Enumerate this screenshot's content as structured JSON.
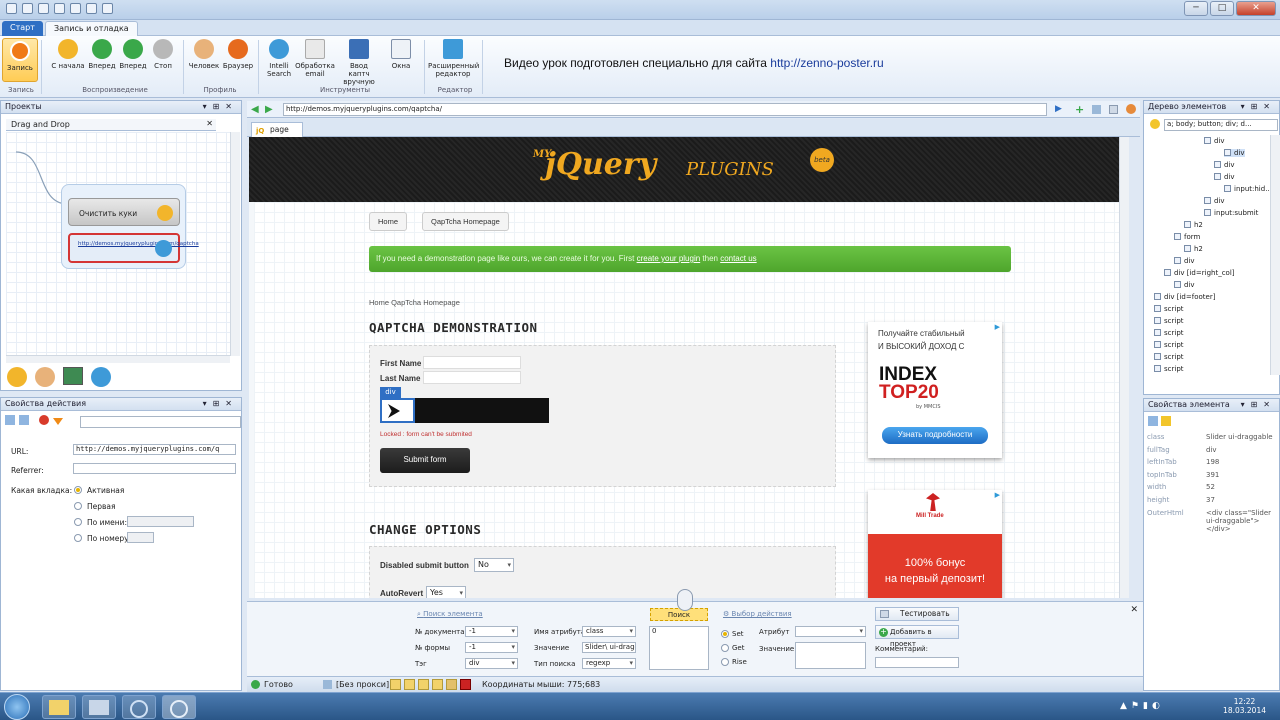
{
  "titlebar": {
    "buttons": [
      "─",
      "□",
      "✕"
    ]
  },
  "tabs": {
    "start": "Старт",
    "record": "Запись и отладка"
  },
  "ribbon": {
    "buttons": [
      {
        "label": "Запись",
        "icon": "record-icon",
        "color": "#f07a16"
      },
      {
        "label": "С начала",
        "icon": "restart-icon",
        "color": "#f2b52b"
      },
      {
        "label": "Вперед",
        "icon": "play-icon",
        "color": "#3aa84a"
      },
      {
        "label": "Вперед",
        "icon": "step-forward-icon",
        "color": "#3aa84a"
      },
      {
        "label": "Стоп",
        "icon": "stop-icon",
        "color": "#b8b8b8"
      },
      {
        "label": "Человек",
        "icon": "person-icon",
        "color": "#e8b27a"
      },
      {
        "label": "Браузер",
        "icon": "browser-icon",
        "color": "#e66a1e"
      },
      {
        "label": "Intelli Search",
        "icon": "intelli-search-icon",
        "color": "#3e9ad8"
      },
      {
        "label": "Обработка email",
        "icon": "email-icon",
        "color": "#d9d9d9"
      },
      {
        "label": "Ввод каптч вручную",
        "icon": "captcha-icon",
        "color": "#3b6fb6"
      },
      {
        "label": "Окна",
        "icon": "windows-icon",
        "color": "#cfd8e4"
      },
      {
        "label": "Расширенный редактор",
        "icon": "expand-editor-icon",
        "color": "#3e9ad8"
      }
    ],
    "groups": [
      "Запись",
      "Воспроизведение",
      "Профиль",
      "Инструменты",
      "Редактор"
    ]
  },
  "promo": {
    "text": "Видео урок подготовлен специально для сайта ",
    "link": "http://zenno-poster.ru"
  },
  "projects": {
    "title": "Проекты",
    "tab": "Drag and Drop",
    "node1": "Очистить куки",
    "node2": "http://demos.myjqueryplugins.com/qaptcha"
  },
  "props": {
    "title": "Свойства действия",
    "url_label": "URL:",
    "url_value": "http://demos.myjqueryplugins.com/q",
    "referrer_label": "Referrer:",
    "tab_label": "Какая вкладка:",
    "options": [
      "Активная",
      "Первая",
      "По имени:",
      "По номеру:"
    ]
  },
  "browser": {
    "address": "http://demos.myjqueryplugins.com/qaptcha/",
    "tab": "page"
  },
  "site": {
    "logo_my": "MY",
    "logo_main": "jQuery",
    "logo_plugins": "PLUGINS",
    "logo_beta": "beta",
    "nav": [
      "Home",
      "QapTcha Homepage"
    ],
    "notice": "If you need a demonstration page like ours, we can create it for you. First ",
    "notice_link1": "create your plugin",
    "notice_mid": " then ",
    "notice_link2": "contact us",
    "breadcrumb": "Home QapTcha Homepage",
    "h_demo": "QAPTCHA DEMONSTRATION",
    "first_name": "First Name",
    "last_name": "Last Name",
    "div_tag": "div",
    "locked": "Locked : form can't be submited",
    "submit": "Submit form",
    "h_options": "CHANGE OPTIONS",
    "disabled_label": "Disabled submit button",
    "disabled_value": "No",
    "autorevert_label": "AutoRevert",
    "autorevert_value": "Yes"
  },
  "ads": {
    "ad1_line1": "Получайте стабильный",
    "ad1_line2": "И ВЫСОКИЙ ДОХОД С",
    "ad1_logo1": "INDEX",
    "ad1_logo2": "TOP20",
    "ad1_by": "by MMCIS",
    "ad1_btn": "Узнать подробности",
    "ad2_logo": "Mill Trade",
    "ad2_line1": "100% бонус",
    "ad2_line2": "на первый депозит!"
  },
  "tree": {
    "title": "Дерево элементов",
    "path": "a; body; button; div; d...",
    "items": [
      "div",
      "div",
      "div",
      "div",
      "input:hid...",
      "div",
      "input:submit",
      "h2",
      "form",
      "h2",
      "div",
      "div [id=right_col]",
      "div",
      "div [id=footer]",
      "script",
      "script",
      "script",
      "script",
      "script",
      "script"
    ]
  },
  "element_props": {
    "title": "Свойства элемента",
    "rows": [
      {
        "k": "class",
        "v": "Slider ui-draggable"
      },
      {
        "k": "fullTag",
        "v": "div"
      },
      {
        "k": "leftInTab",
        "v": "198"
      },
      {
        "k": "topInTab",
        "v": "391"
      },
      {
        "k": "width",
        "v": "52"
      },
      {
        "k": "height",
        "v": "37"
      },
      {
        "k": "OuterHtml",
        "v": "<div class=\"Slider ui-draggable\"></div>"
      }
    ]
  },
  "bottom": {
    "search_el": "Поиск элемента",
    "doc_label": "№ документа",
    "doc_val": "-1",
    "form_label": "№ формы",
    "form_val": "-1",
    "tag_label": "Тэг",
    "tag_val": "div",
    "attr_label": "Имя атрибута",
    "attr_val": "class",
    "value_label": "Значение",
    "value_val": "Slider\\ ui-dragga",
    "stype_label": "Тип поиска",
    "stype_val": "regexp",
    "search_btn": "Поиск",
    "result": "0",
    "action_choice": "Выбор действия",
    "set": "Set",
    "get": "Get",
    "rise": "Rise",
    "attr2_label": "Атрибут",
    "value2_label": "Значение",
    "test_btn": "Тестировать",
    "add_btn": "Добавить в проект",
    "comment_label": "Комментарий:"
  },
  "status": {
    "ready": "Готово",
    "proxy": "[Без прокси]",
    "coords": "Координаты мыши: 775;683"
  },
  "taskbar": {
    "time": "12:22",
    "date": "18.03.2014"
  }
}
